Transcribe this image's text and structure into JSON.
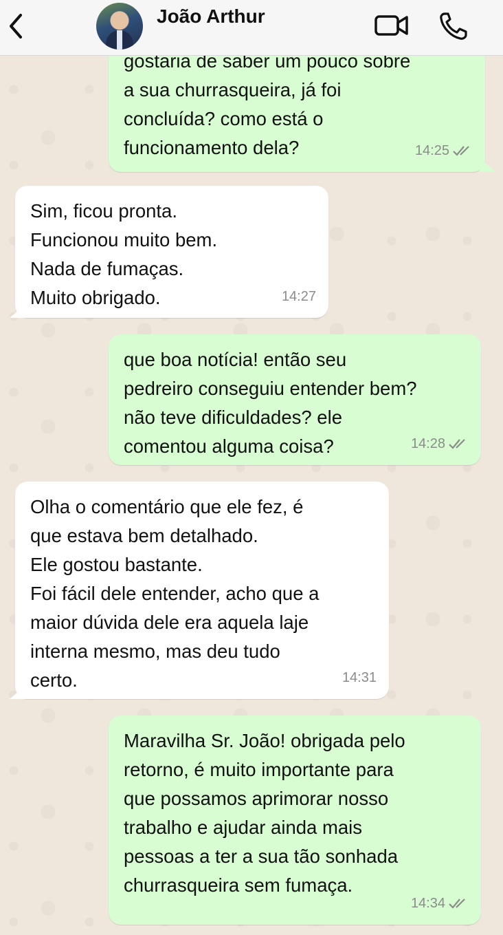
{
  "header": {
    "contact_name": "João Arthur"
  },
  "messages": [
    {
      "direction": "out",
      "lines": [
        "gostaria de saber um pouco sobre",
        "a sua churrasqueira, já foi",
        "concluída? como está o",
        "funcionamento dela?"
      ],
      "time": "14:25",
      "read": true
    },
    {
      "direction": "in",
      "lines": [
        "Sim, ficou pronta.",
        "Funcionou muito bem.",
        "Nada de fumaças.",
        "Muito obrigado."
      ],
      "time": "14:27"
    },
    {
      "direction": "out",
      "lines": [
        "que boa notícia! então seu",
        "pedreiro conseguiu entender bem?",
        "não teve dificuldades? ele",
        "comentou alguma coisa?"
      ],
      "time": "14:28",
      "read": true
    },
    {
      "direction": "in",
      "lines": [
        "Olha o comentário que ele fez, é",
        "que estava bem detalhado.",
        "Ele gostou bastante.",
        "Foi fácil dele entender, acho que a",
        "maior dúvida dele era aquela laje",
        "interna mesmo, mas deu tudo",
        "certo."
      ],
      "time": "14:31"
    },
    {
      "direction": "out",
      "lines": [
        "Maravilha Sr. João! obrigada pelo",
        "retorno, é muito importante para",
        "que possamos aprimorar nosso",
        "trabalho e ajudar ainda mais",
        "pessoas a ter a sua tão sonhada",
        "churrasqueira sem fumaça."
      ],
      "time": "14:34",
      "read": true
    }
  ],
  "colors": {
    "incoming_bubble": "#ffffff",
    "outgoing_bubble": "#d8fdd2",
    "chat_background": "#efe7dc",
    "read_ticks": "#8b8b8b"
  },
  "icons": [
    "chevron-left-icon",
    "video-camera-icon",
    "phone-icon",
    "double-check-icon"
  ]
}
